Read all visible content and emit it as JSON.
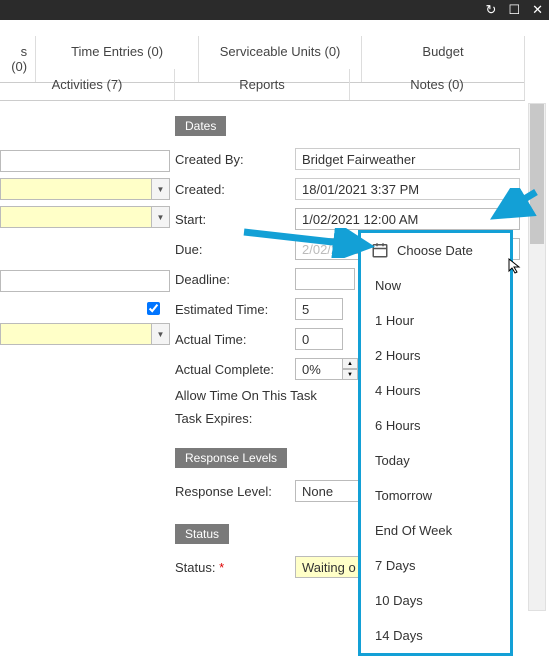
{
  "titlebar": {
    "refresh": "↻",
    "maximize": "☐",
    "close": "✕"
  },
  "tabsRow1": {
    "t0": "s (0)",
    "t1": "Time Entries (0)",
    "t2": "Serviceable Units (0)",
    "t3": "Budget"
  },
  "tabsRow2": {
    "t0": "Activities (7)",
    "t1": "Reports",
    "t2": "Notes (0)"
  },
  "dates": {
    "header": "Dates",
    "createdBy_label": "Created By:",
    "createdBy": "Bridget Fairweather",
    "created_label": "Created:",
    "created": "18/01/2021 3:37 PM",
    "start_label": "Start:",
    "start": "1/02/2021 12:00 AM",
    "due_label": "Due:",
    "due": "2/02/2021",
    "deadline_label": "Deadline:",
    "deadline": "",
    "estTime_label": "Estimated Time:",
    "estTime": "5",
    "actTime_label": "Actual Time:",
    "actTime": "0",
    "actComplete_label": "Actual Complete:",
    "actComplete": "0%",
    "allowTime_label": "Allow Time On This Task",
    "expires_label": "Task Expires:"
  },
  "responseLevels": {
    "header": "Response Levels",
    "label": "Response Level:",
    "value": "None"
  },
  "status": {
    "header": "Status",
    "label": "Status:",
    "req": "*",
    "value": "Waiting o"
  },
  "dateMenu": {
    "choose": "Choose Date",
    "items": {
      "i0": "Now",
      "i1": "1 Hour",
      "i2": "2 Hours",
      "i3": "4 Hours",
      "i4": "6 Hours",
      "i5": "Today",
      "i6": "Tomorrow",
      "i7": "End Of Week",
      "i8": "7 Days",
      "i9": "10 Days",
      "i10": "14 Days"
    }
  }
}
